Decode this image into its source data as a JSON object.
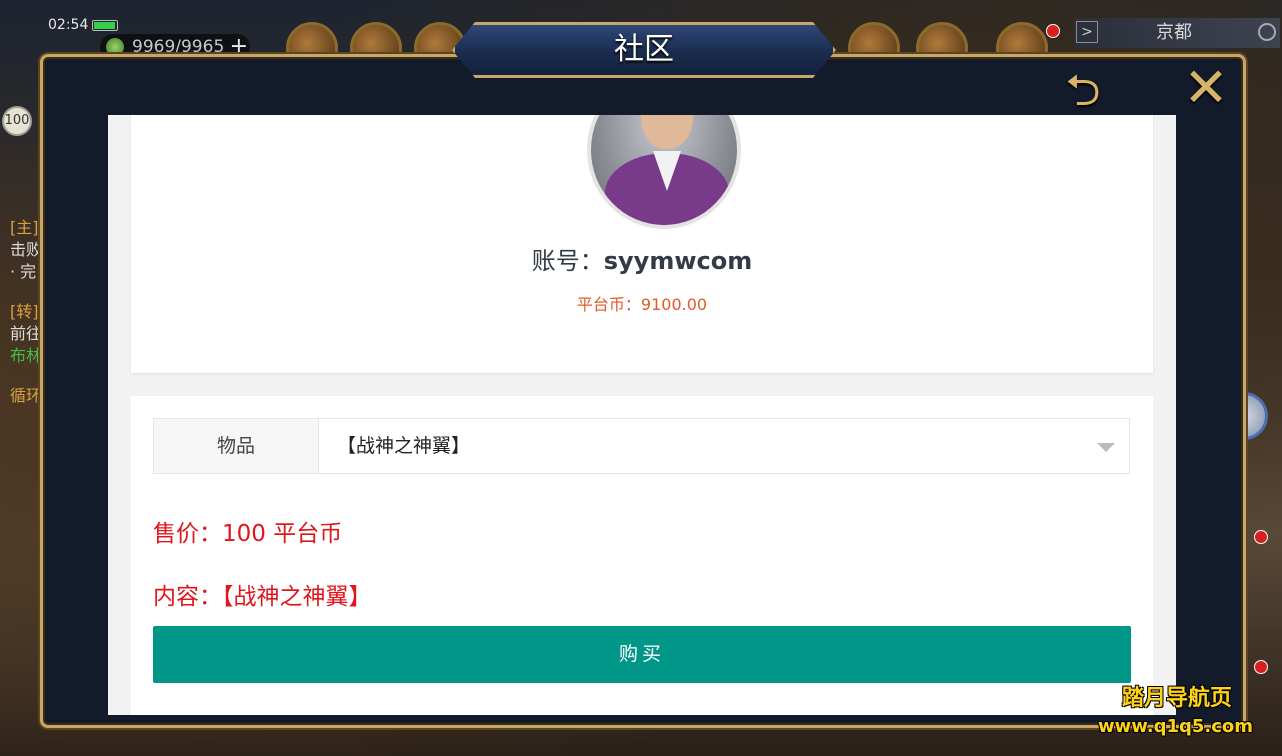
{
  "status_bar": {
    "time": "02:54",
    "battery_level": 0.95
  },
  "hud": {
    "currency": "9969/9965",
    "plus_glyph": "+",
    "city": "京都",
    "level": "100",
    "side_lines": [
      "[主]",
      "击败",
      "· 完",
      "[转]",
      "前往",
      "布林",
      "循环"
    ]
  },
  "modal": {
    "title": "社区",
    "back_glyph": "⮌",
    "close_glyph": "✕"
  },
  "profile": {
    "account_label": "账号：",
    "account_value": "syymwcom",
    "balance_text": "平台币：9100.00"
  },
  "order": {
    "item_label": "物品",
    "item_value": "【战神之神翼】",
    "price_text": "售价：100 平台币",
    "content_text": "内容：【战神之神翼】",
    "buy_label": "购买"
  },
  "watermark": {
    "title": "踏月导航页",
    "url": "www.q1q5.com"
  },
  "colors": {
    "primary_button": "#009688",
    "price_red": "#e0161d",
    "balance_orange": "#e05a2a",
    "frame_gold": "#c8a868"
  }
}
